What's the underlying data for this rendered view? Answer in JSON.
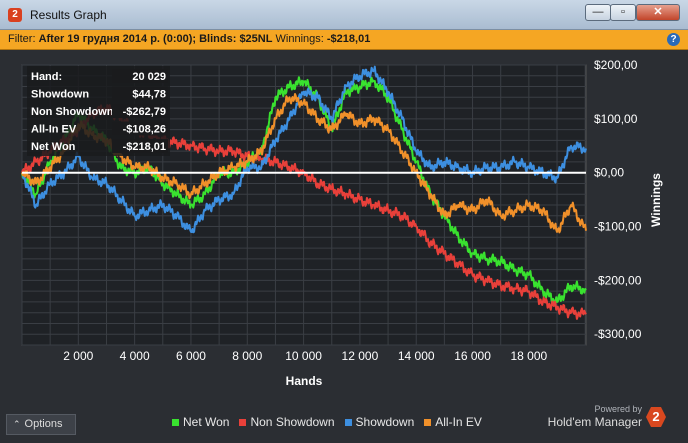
{
  "window": {
    "title": "Results Graph",
    "app_icon": "2"
  },
  "filter": {
    "label": "Filter:",
    "date": "After 19 грудня 2014 р. (0:00);",
    "blinds": "Blinds: $25NL",
    "winnings_label": "Winnings:",
    "winnings_value": "-$218,01",
    "help": "?"
  },
  "stats": [
    {
      "label": "Hand:",
      "value": "20 029"
    },
    {
      "label": "Showdown",
      "value": "$44,78"
    },
    {
      "label": "Non Showdown",
      "value": "-$262,79"
    },
    {
      "label": "All-In EV",
      "value": "-$108,26"
    },
    {
      "label": "Net Won",
      "value": "-$218,01"
    }
  ],
  "options_label": "Options",
  "brand": {
    "powered": "Powered by",
    "name": "Hold'em Manager",
    "logo": "2"
  },
  "colors": {
    "net_won": "#39e22f",
    "non_showdown": "#e8403a",
    "showdown": "#3d8fe0",
    "allin_ev": "#f0902a",
    "zero_line": "#ffffff",
    "filter_bg": "#f5a623"
  },
  "chart_data": {
    "type": "line",
    "xlabel": "Hands",
    "ylabel": "Winnings",
    "xlim": [
      0,
      20029
    ],
    "ylim": [
      -320,
      200
    ],
    "x_ticks": [
      2000,
      4000,
      6000,
      8000,
      10000,
      12000,
      14000,
      16000,
      18000
    ],
    "x_tick_labels": [
      "2 000",
      "4 000",
      "6 000",
      "8 000",
      "10 000",
      "12 000",
      "14 000",
      "16 000",
      "18 000"
    ],
    "y_ticks": [
      200,
      100,
      0,
      -100,
      -200,
      -300
    ],
    "y_tick_labels": [
      "$200,00",
      "$100,00",
      "$0,00",
      "-$100,00",
      "-$200,00",
      "-$300,00"
    ],
    "grid": true,
    "legend_position": "bottom",
    "x": [
      0,
      500,
      1000,
      1500,
      2000,
      2500,
      3000,
      3500,
      4000,
      4500,
      5000,
      5500,
      6000,
      6500,
      7000,
      7500,
      8000,
      8500,
      9000,
      9500,
      10000,
      10500,
      11000,
      11500,
      12000,
      12500,
      13000,
      13500,
      14000,
      14500,
      15000,
      15500,
      16000,
      16500,
      17000,
      17500,
      18000,
      18500,
      19000,
      19500,
      20029
    ],
    "series": [
      {
        "name": "Net Won",
        "color": "#39e22f",
        "values": [
          0,
          -40,
          20,
          60,
          110,
          80,
          60,
          10,
          0,
          10,
          -20,
          -40,
          -60,
          -40,
          0,
          0,
          20,
          40,
          140,
          160,
          170,
          140,
          80,
          150,
          160,
          170,
          140,
          80,
          20,
          -40,
          -80,
          -120,
          -150,
          -160,
          -165,
          -180,
          -190,
          -220,
          -240,
          -210,
          -218
        ]
      },
      {
        "name": "Non Showdown",
        "color": "#e8403a",
        "values": [
          0,
          20,
          40,
          60,
          80,
          110,
          120,
          100,
          80,
          70,
          60,
          55,
          50,
          45,
          40,
          40,
          30,
          25,
          20,
          10,
          0,
          -20,
          -30,
          -40,
          -50,
          -60,
          -70,
          -80,
          -100,
          -130,
          -150,
          -170,
          -190,
          -200,
          -210,
          -215,
          -220,
          -240,
          -250,
          -260,
          -263
        ]
      },
      {
        "name": "Showdown",
        "color": "#3d8fe0",
        "values": [
          0,
          -60,
          -20,
          0,
          30,
          -10,
          -20,
          -50,
          -80,
          -70,
          -60,
          -80,
          -110,
          -70,
          -50,
          -40,
          10,
          10,
          60,
          100,
          150,
          140,
          100,
          160,
          180,
          190,
          150,
          100,
          40,
          10,
          20,
          10,
          0,
          10,
          10,
          20,
          10,
          0,
          -10,
          50,
          45
        ]
      },
      {
        "name": "All-In EV",
        "color": "#f0902a",
        "values": [
          0,
          -20,
          10,
          40,
          90,
          70,
          60,
          30,
          10,
          10,
          -10,
          -20,
          -40,
          -20,
          0,
          10,
          20,
          40,
          100,
          140,
          130,
          100,
          80,
          110,
          90,
          100,
          80,
          40,
          0,
          -40,
          -80,
          -60,
          -70,
          -50,
          -80,
          -70,
          -60,
          -70,
          -110,
          -60,
          -108
        ]
      }
    ]
  }
}
